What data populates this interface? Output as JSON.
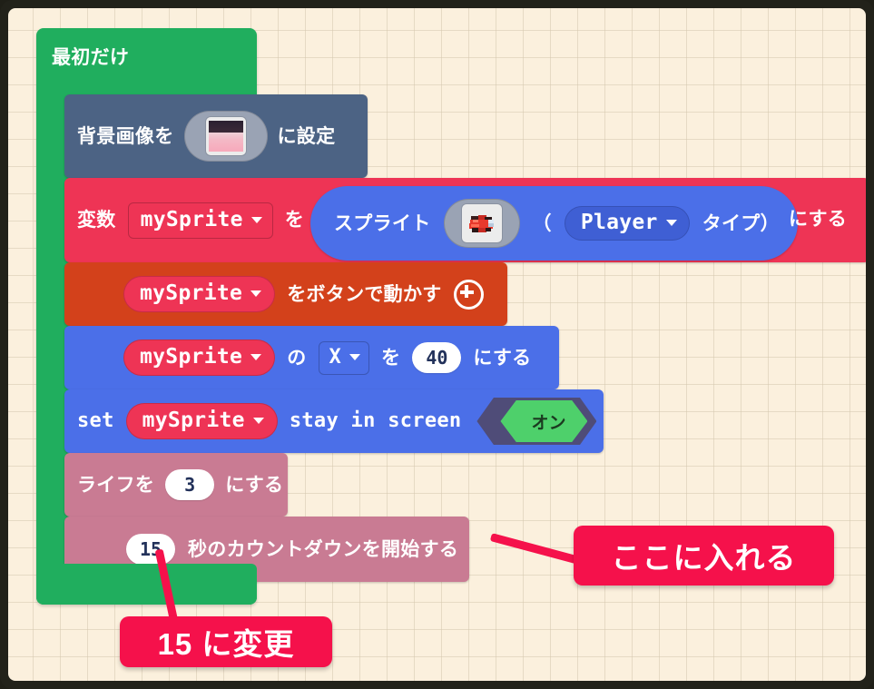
{
  "editor": {
    "name": "makecode-arcade-blocks-workspace",
    "background_color": "#fbf0dd",
    "grid_color": "#d6c8af",
    "frame_color": "#22221a"
  },
  "event_block": {
    "label": "最初だけ",
    "color": "#20ae5e"
  },
  "blocks": [
    {
      "id": "set-background-image",
      "color": "#4c6384",
      "text_before": "背景画像を",
      "image_field": "background-image-thumbnail",
      "text_after": "に設定"
    },
    {
      "id": "set-variable-to-sprite",
      "color": "#ee3455",
      "text_before": "変数",
      "variable": "mySprite",
      "text_mid": "を",
      "reporter": {
        "color": "#4b6fe8",
        "label": "スプライト",
        "image_field": "plane-sprite-thumbnail",
        "paren_open": "（",
        "kind": "Player",
        "paren_close": "タイプ）"
      },
      "text_after": "にする"
    },
    {
      "id": "move-with-buttons",
      "color": "#d3411b",
      "variable": "mySprite",
      "text_after": "をボタンで動かす",
      "icon": "plus-circle-icon"
    },
    {
      "id": "set-sprite-x",
      "color": "#4b6fe8",
      "variable": "mySprite",
      "text_mid1": "の",
      "property": "X",
      "text_mid2": "を",
      "value": "40",
      "text_after": "にする"
    },
    {
      "id": "stay-in-screen",
      "color": "#4b6fe8",
      "text_before": "set",
      "variable": "mySprite",
      "text_mid": "stay in screen",
      "toggle": "オン",
      "toggle_color": "#4ed06b"
    },
    {
      "id": "set-life",
      "color": "#c97b93",
      "text_before": "ライフを",
      "value": "3",
      "text_after": "にする"
    },
    {
      "id": "start-countdown",
      "color": "#c97b93",
      "value": "15",
      "text_after": "秒のカウントダウンを開始する"
    }
  ],
  "annotations": [
    {
      "id": "callout-insert-here",
      "label": "ここに入れる",
      "color": "#f5114b"
    },
    {
      "id": "callout-change-to-15",
      "label": "15 に変更",
      "color": "#f5114b"
    }
  ]
}
